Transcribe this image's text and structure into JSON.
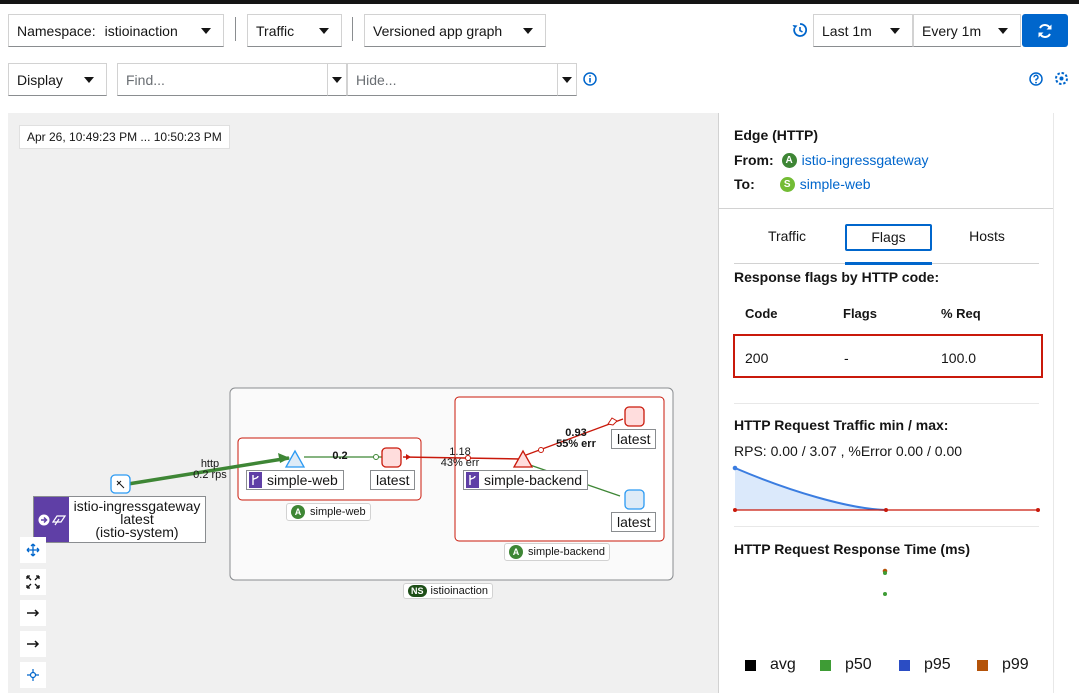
{
  "toolbar": {
    "namespace_label": "Namespace:",
    "namespace_value": "istioinaction",
    "traffic_label": "Traffic",
    "graph_type": "Versioned app graph",
    "duration": "Last 1m",
    "refresh_interval": "Every 1m",
    "display_label": "Display",
    "find_placeholder": "Find...",
    "hide_placeholder": "Hide..."
  },
  "graph": {
    "timestamp": "Apr 26, 10:49:23 PM ... 10:50:23 PM",
    "gateway": {
      "name": "istio-ingressgateway",
      "version": "latest",
      "namespace": "(istio-system)"
    },
    "edges": {
      "gw_web": {
        "protocol": "http",
        "rate": "0.2 rps"
      },
      "web_latest": "0.2",
      "latest_backend": {
        "rate": "1.18",
        "err": "43% err"
      },
      "backend_up": {
        "rate": "0.93",
        "err": "55% err"
      }
    },
    "service_web": "simple-web",
    "service_backend": "simple-backend",
    "workload_web_version": "latest",
    "workload_backend_v1": "latest",
    "workload_backend_v2": "latest",
    "app_box_web": "simple-web",
    "app_box_backend": "simple-backend",
    "namespace_box": "istioinaction",
    "badge_app": "A",
    "badge_ns": "NS"
  },
  "panel": {
    "title": "Edge (HTTP)",
    "from_label": "From:",
    "from_badge": "A",
    "from_value": "istio-ingressgateway",
    "to_label": "To:",
    "to_badge": "S",
    "to_value": "simple-web",
    "tabs": [
      "Traffic",
      "Flags",
      "Hosts"
    ],
    "active_tab": "Flags",
    "flags_title": "Response flags by HTTP code:",
    "table_headers": [
      "Code",
      "Flags",
      "% Req"
    ],
    "table_rows": [
      [
        "200",
        "-",
        "100.0"
      ]
    ],
    "traffic_title": "HTTP Request Traffic min / max:",
    "traffic_stats": "RPS: 0.00 / 3.07 , %Error 0.00 / 0.00",
    "response_time_title": "HTTP Request Response Time (ms)",
    "legend": [
      {
        "label": "avg",
        "color": "#000000"
      },
      {
        "label": "p50",
        "color": "#3e9c35"
      },
      {
        "label": "p95",
        "color": "#2b4dc4"
      },
      {
        "label": "p99",
        "color": "#b45309"
      }
    ]
  },
  "colors": {
    "accent": "#0066cc",
    "error": "#c9190b",
    "healthy": "#3e8635",
    "workload_purple": "#5f3fa6"
  }
}
